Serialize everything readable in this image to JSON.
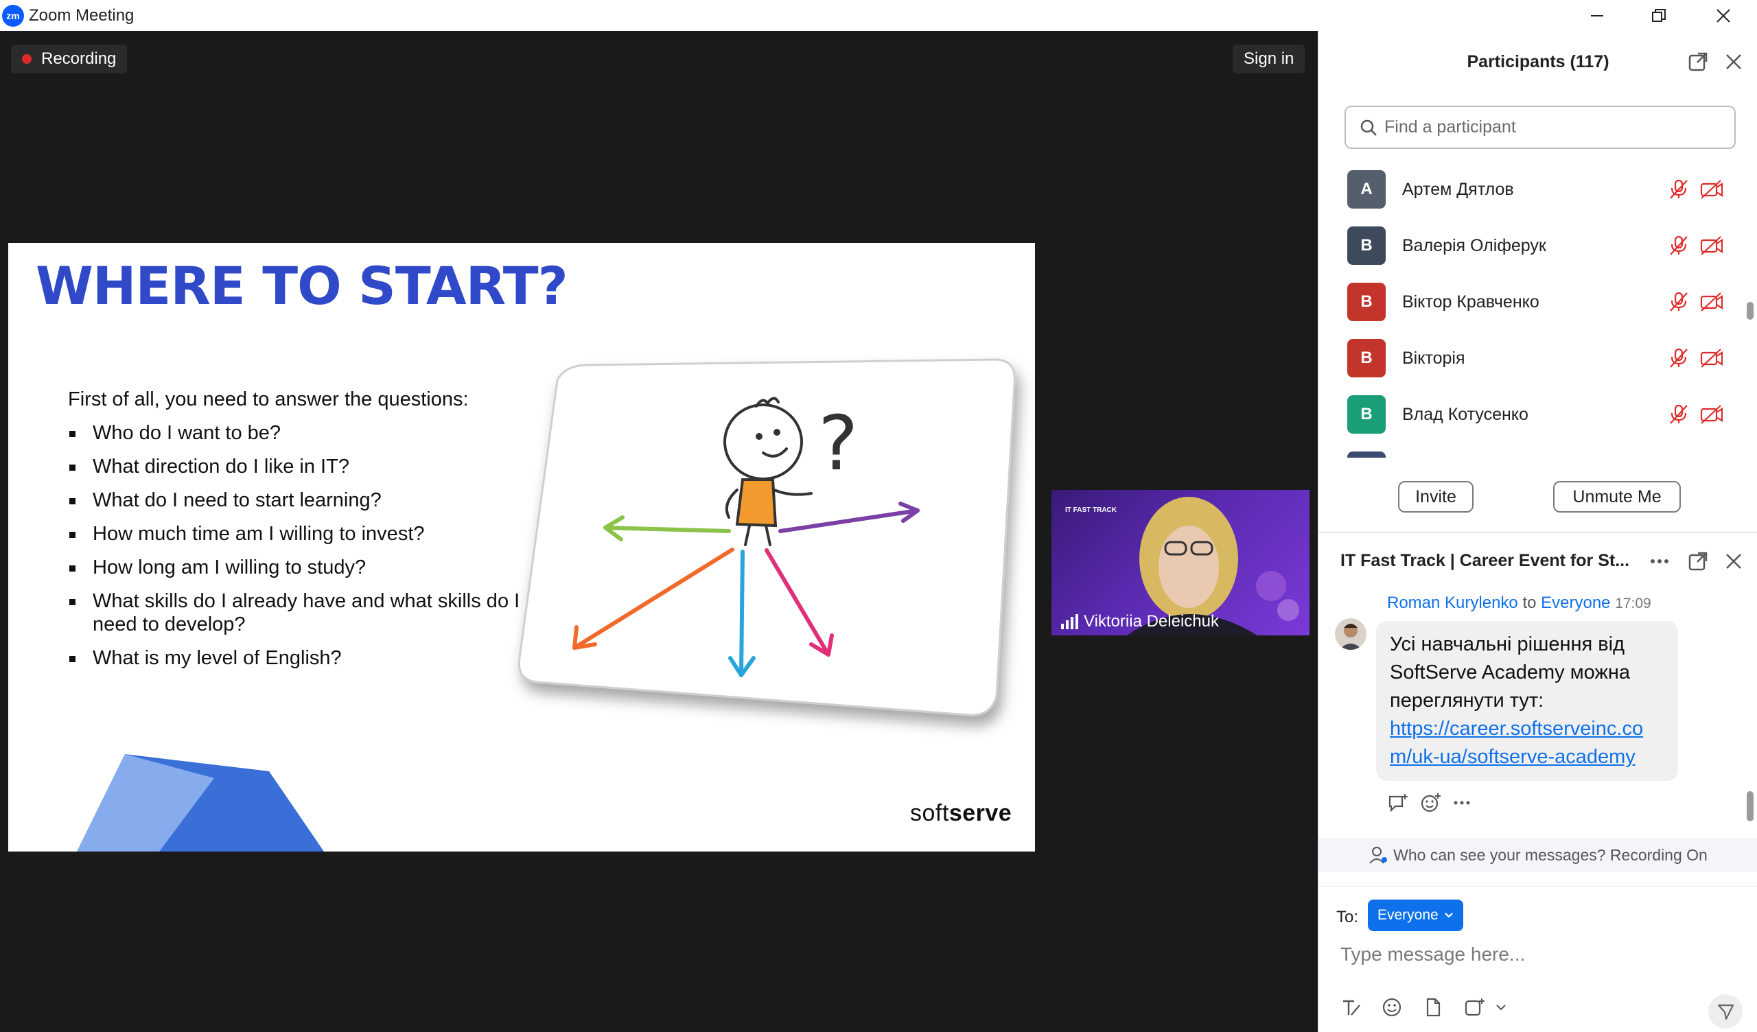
{
  "window": {
    "title": "Zoom Meeting",
    "logo_text": "zm"
  },
  "meeting": {
    "recording_label": "Recording",
    "signin_label": "Sign in"
  },
  "slide": {
    "title": "WHERE TO START?",
    "intro": "First of all, you need to answer the questions:",
    "bullets": [
      "Who do I want to be?",
      "What direction do I like in IT?",
      "What do I need to start learning?",
      "How much time am I willing to invest?",
      "How long am I willing to study?",
      "What skills do I already have and what skills do I need to develop?",
      "What is my level of English?"
    ],
    "brand_light": "soft",
    "brand_bold": "serve"
  },
  "video": {
    "name": "Viktoriia Deleichuk",
    "overlay_text": "IT FAST TRACK"
  },
  "participants": {
    "header": "Participants (117)",
    "search_placeholder": "Find a participant",
    "list": [
      {
        "initial": "A",
        "name": "Артем Дятлов",
        "color": "#555f6b"
      },
      {
        "initial": "В",
        "name": "Валерія Оліферук",
        "color": "#3d4a5c"
      },
      {
        "initial": "В",
        "name": "Віктор Кравченко",
        "color": "#c3352b"
      },
      {
        "initial": "В",
        "name": "Вікторія",
        "color": "#c3352b"
      },
      {
        "initial": "В",
        "name": "Влад Котусенко",
        "color": "#1a9e77"
      }
    ],
    "invite_label": "Invite",
    "unmute_label": "Unmute Me"
  },
  "chat": {
    "title": "IT Fast Track | Career Event for St...",
    "sender": "Roman Kurylenko",
    "to_word": "to",
    "recipient": "Everyone",
    "time": "17:09",
    "message": "Усі навчальні рішення від SoftServe Academy можна переглянути тут:",
    "link": "https://career.softserveinc.com/uk-ua/softserve-academy",
    "notice": "Who can see your messages? Recording On",
    "to_label": "To:",
    "to_value": "Everyone",
    "input_placeholder": "Type message here..."
  },
  "colors": {
    "accent_blue": "#0e71eb",
    "slide_title": "#2f49c8",
    "mute_red": "#e02a2a"
  }
}
